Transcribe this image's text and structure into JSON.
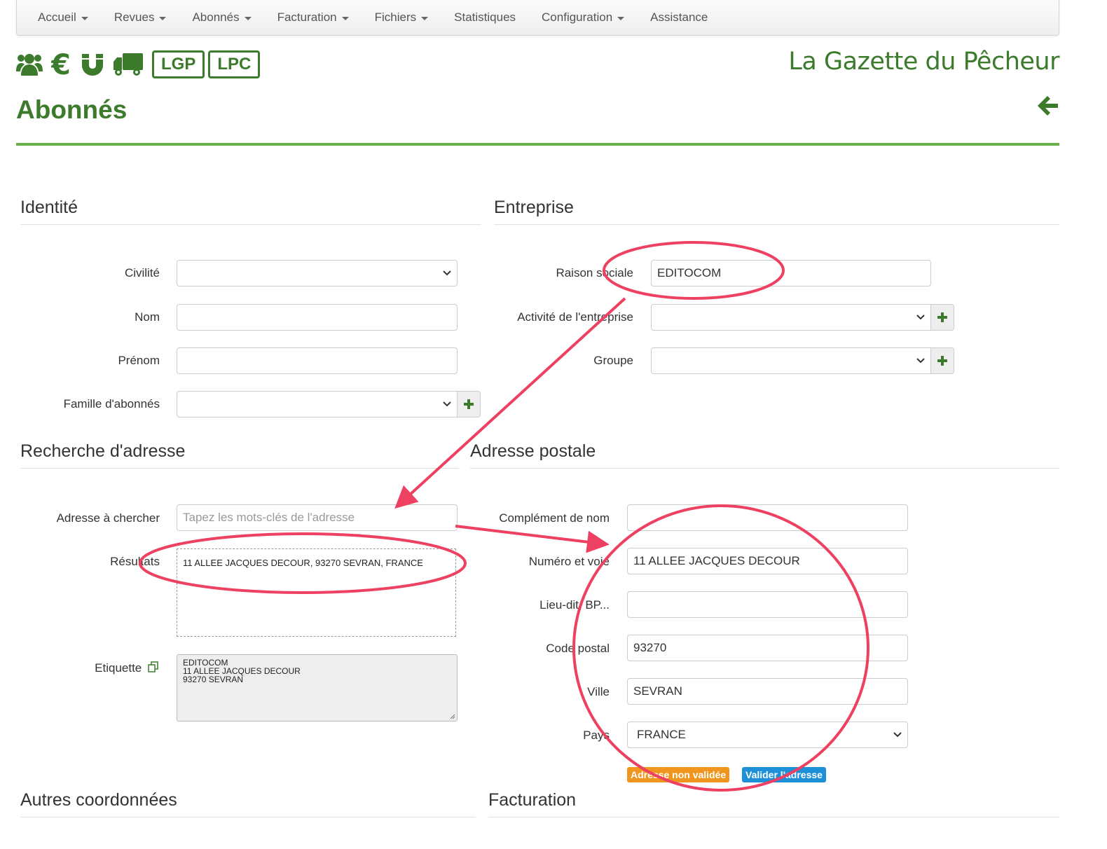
{
  "nav": {
    "items": [
      {
        "label": "Accueil",
        "dropdown": true
      },
      {
        "label": "Revues",
        "dropdown": true
      },
      {
        "label": "Abonnés",
        "dropdown": true
      },
      {
        "label": "Facturation",
        "dropdown": true
      },
      {
        "label": "Fichiers",
        "dropdown": true
      },
      {
        "label": "Statistiques",
        "dropdown": false
      },
      {
        "label": "Configuration",
        "dropdown": true
      },
      {
        "label": "Assistance",
        "dropdown": false
      }
    ]
  },
  "brand": {
    "icons": [
      "users-icon",
      "euro-icon",
      "magnet-icon",
      "truck-icon"
    ],
    "pills": [
      "LGP",
      "LPC"
    ],
    "site_title": "La Gazette du Pêcheur",
    "accent": "#3c7a2c"
  },
  "page": {
    "title": "Abonnés"
  },
  "sections": {
    "identite": "Identité",
    "entreprise": "Entreprise",
    "recherche": "Recherche d'adresse",
    "adresse_postale": "Adresse postale",
    "autres": "Autres coordonnées",
    "facturation": "Facturation"
  },
  "identite": {
    "civilite_label": "Civilité",
    "civilite_value": "",
    "nom_label": "Nom",
    "nom_value": "",
    "prenom_label": "Prénom",
    "prenom_value": "",
    "famille_label": "Famille d'abonnés",
    "famille_value": ""
  },
  "entreprise": {
    "raison_label": "Raison sociale",
    "raison_value": "EDITOCOM",
    "activite_label": "Activité de l'entreprise",
    "activite_value": "",
    "groupe_label": "Groupe",
    "groupe_value": ""
  },
  "recherche": {
    "adresse_label": "Adresse à chercher",
    "adresse_placeholder": "Tapez les mots-clés de l'adresse",
    "resultats_label": "Résultats",
    "resultats": [
      "11 ALLEE JACQUES DECOUR, 93270 SEVRAN, FRANCE"
    ],
    "etiquette_label": "Etiquette",
    "etiquette_lines": [
      "EDITOCOM",
      "11 ALLEE JACQUES DECOUR",
      "93270 SEVRAN"
    ]
  },
  "adresse": {
    "complement_label": "Complément de nom",
    "complement_value": "",
    "numero_label": "Numéro et voie",
    "numero_value": "11 ALLEE JACQUES DECOUR",
    "lieudit_label": "Lieu-dit, BP...",
    "lieudit_value": "",
    "cp_label": "Code postal",
    "cp_value": "93270",
    "ville_label": "Ville",
    "ville_value": "SEVRAN",
    "pays_label": "Pays",
    "pays_value": "FRANCE",
    "badge_non_validee": "Adresse non validée",
    "badge_valider": "Valider l'adresse",
    "badge_orange": "#f0961e",
    "badge_blue": "#1e90d8"
  },
  "annotation_color": "#ee4060"
}
